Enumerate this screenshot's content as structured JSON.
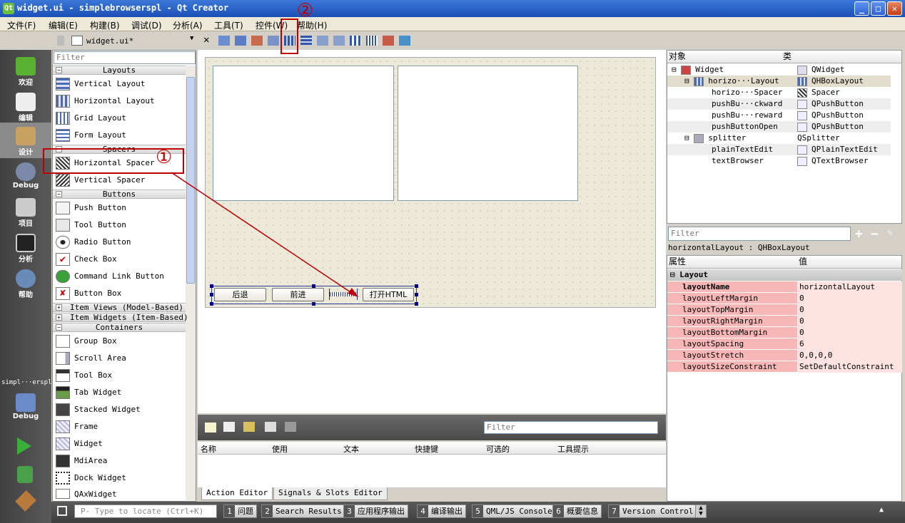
{
  "window": {
    "title": "widget.ui - simplebrowserspl - Qt Creator",
    "app_icon": "Qt",
    "controls": [
      "_",
      "□",
      "✕"
    ]
  },
  "menu": [
    "文件(F)",
    "编辑(E)",
    "构建(B)",
    "调试(D)",
    "分析(A)",
    "工具(T)",
    "控件(W)",
    "帮助(H)"
  ],
  "doc_selector": {
    "file": "widget.ui*"
  },
  "modes": [
    {
      "label": "欢迎"
    },
    {
      "label": "编辑"
    },
    {
      "label": "设计"
    },
    {
      "label": "Debug"
    },
    {
      "label": "项目"
    },
    {
      "label": "分析"
    },
    {
      "label": "帮助"
    }
  ],
  "project_target": {
    "name": "simpl···erspl",
    "config": "Debug"
  },
  "widget_box": {
    "filter_placeholder": "Filter",
    "cat_layouts": "Layouts",
    "layouts": [
      "Vertical Layout",
      "Horizontal Layout",
      "Grid Layout",
      "Form Layout"
    ],
    "cat_spacers": "Spacers",
    "spacers": [
      "Horizontal Spacer",
      "Vertical Spacer"
    ],
    "cat_buttons": "Buttons",
    "buttons": [
      "Push Button",
      "Tool Button",
      "Radio Button",
      "Check Box",
      "Command Link Button",
      "Button Box"
    ],
    "cat_item_views": "Item Views (Model-Based)",
    "cat_item_widgets": "Item Widgets (Item-Based)",
    "cat_containers": "Containers",
    "containers": [
      "Group Box",
      "Scroll Area",
      "Tool Box",
      "Tab Widget",
      "Stacked Widget",
      "Frame",
      "Widget",
      "MdiArea",
      "Dock Widget",
      "QAxWidget"
    ]
  },
  "form": {
    "buttons": {
      "back": "后退",
      "forward": "前进",
      "open": "打开HTML"
    }
  },
  "action_editor": {
    "filter_placeholder": "Filter",
    "columns": [
      "名称",
      "使用",
      "文本",
      "快捷键",
      "可选的",
      "工具提示"
    ],
    "tabs": [
      "Action Editor",
      "Signals & Slots Editor"
    ]
  },
  "object_inspector": {
    "col_object": "对象",
    "col_class": "类",
    "rows": [
      {
        "name": "Widget",
        "cls": "QWidget"
      },
      {
        "name": "horizo···Layout",
        "cls": "QHBoxLayout"
      },
      {
        "name": "horizo···Spacer",
        "cls": "Spacer"
      },
      {
        "name": "pushBu···ckward",
        "cls": "QPushButton"
      },
      {
        "name": "pushBu···reward",
        "cls": "QPushButton"
      },
      {
        "name": "pushButtonOpen",
        "cls": "QPushButton"
      },
      {
        "name": "splitter",
        "cls": "QSplitter"
      },
      {
        "name": "plainTextEdit",
        "cls": "QPlainTextEdit"
      },
      {
        "name": "textBrowser",
        "cls": "QTextBrowser"
      }
    ]
  },
  "property_editor": {
    "filter_placeholder": "Filter",
    "object_class": "horizontalLayout : QHBoxLayout",
    "col_property": "属性",
    "col_value": "值",
    "group": "Layout",
    "rows": [
      {
        "name": "layoutName",
        "value": "horizontalLayout"
      },
      {
        "name": "layoutLeftMargin",
        "value": "0"
      },
      {
        "name": "layoutTopMargin",
        "value": "0"
      },
      {
        "name": "layoutRightMargin",
        "value": "0"
      },
      {
        "name": "layoutBottomMargin",
        "value": "0"
      },
      {
        "name": "layoutSpacing",
        "value": "6"
      },
      {
        "name": "layoutStretch",
        "value": "0,0,0,0"
      },
      {
        "name": "layoutSizeConstraint",
        "value": "SetDefaultConstraint"
      }
    ]
  },
  "statusbar": {
    "locate_placeholder": "Type to locate (Ctrl+K)",
    "locate_prefix": "P-",
    "panes": [
      {
        "n": "1",
        "label": "问题"
      },
      {
        "n": "2",
        "label": "Search Results"
      },
      {
        "n": "3",
        "label": "应用程序输出"
      },
      {
        "n": "4",
        "label": "编译输出"
      },
      {
        "n": "5",
        "label": "QML/JS Console"
      },
      {
        "n": "6",
        "label": "概要信息"
      },
      {
        "n": "7",
        "label": "Version Control"
      }
    ]
  },
  "annotations": {
    "one": "①",
    "two": "②"
  },
  "colors": {
    "annotation": "#c00000",
    "property_highlight": "#f8b7b7",
    "selection": "#00008b"
  }
}
